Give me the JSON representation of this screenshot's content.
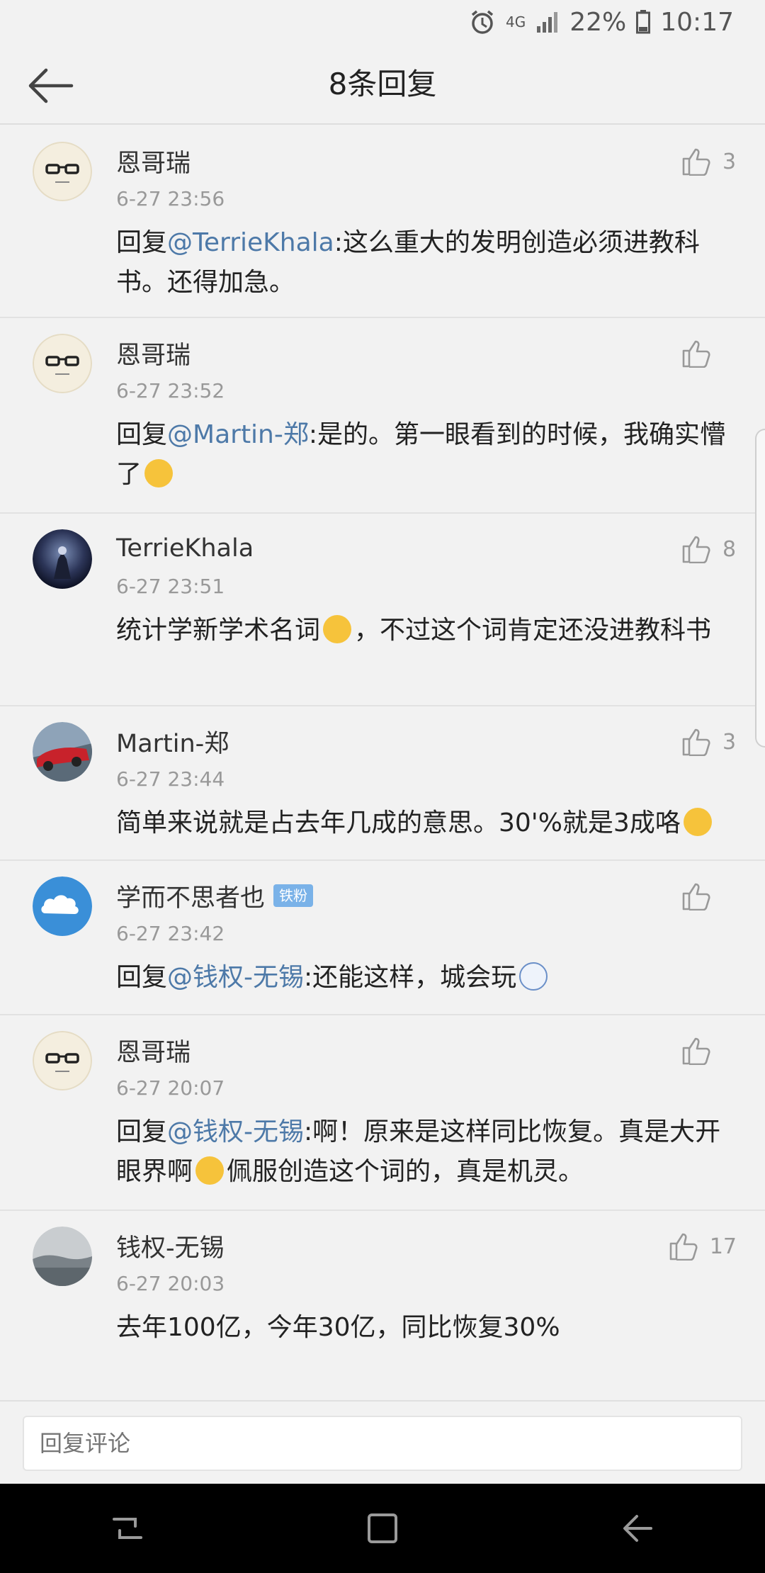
{
  "status": {
    "network": "4G",
    "battery": "22%",
    "time": "10:17",
    "icons": [
      "alarm-icon",
      "network-4g-icon",
      "signal-icon",
      "battery-icon"
    ]
  },
  "header": {
    "title": "8条回复",
    "back_icon": "arrow-left-icon"
  },
  "comments": [
    {
      "name": "恩哥瑞",
      "time": "6-27 23:56",
      "likes": "3",
      "prefix": "回复",
      "mention": "@TerrieKhala",
      "text": ":这么重大的发明创造必须进教科书。还得加急。"
    },
    {
      "name": "恩哥瑞",
      "time": "6-27 23:52",
      "likes": "",
      "prefix": "回复",
      "mention": "@Martin-郑",
      "text": ":是的。第一眼看到的时候，我确实懵了"
    },
    {
      "name": "TerrieKhala",
      "time": "6-27 23:51",
      "likes": "8",
      "prefix": "",
      "mention": "",
      "text": "统计学新学术名词",
      "text2": "，不过这个词肯定还没进教科书"
    },
    {
      "name": "Martin-郑",
      "time": "6-27 23:44",
      "likes": "3",
      "prefix": "",
      "mention": "",
      "text": "简单来说就是占去年几成的意思。30'%就是3成咯"
    },
    {
      "name": "学而不思者也",
      "badge": "铁粉",
      "time": "6-27 23:42",
      "likes": "",
      "prefix": "回复",
      "mention": "@钱权-无锡",
      "text": ":还能这样，城会玩"
    },
    {
      "name": "恩哥瑞",
      "time": "6-27 20:07",
      "likes": "",
      "prefix": "回复",
      "mention": "@钱权-无锡",
      "text": ":啊！原来是这样同比恢复。真是大开眼界啊",
      "text2": "佩服创造这个词的，真是机灵。"
    },
    {
      "name": "钱权-无锡",
      "time": "6-27 20:03",
      "likes": "17",
      "prefix": "",
      "mention": "",
      "text": "去年100亿，今年30亿，同比恢复30%"
    }
  ],
  "reply": {
    "placeholder": "回复评论"
  },
  "nav": {
    "icons": [
      "recents-icon",
      "home-icon",
      "back-icon"
    ]
  },
  "colors": {
    "background": "#f2f2f2",
    "mention": "#4d79a8",
    "badge": "#7ab2e8"
  }
}
